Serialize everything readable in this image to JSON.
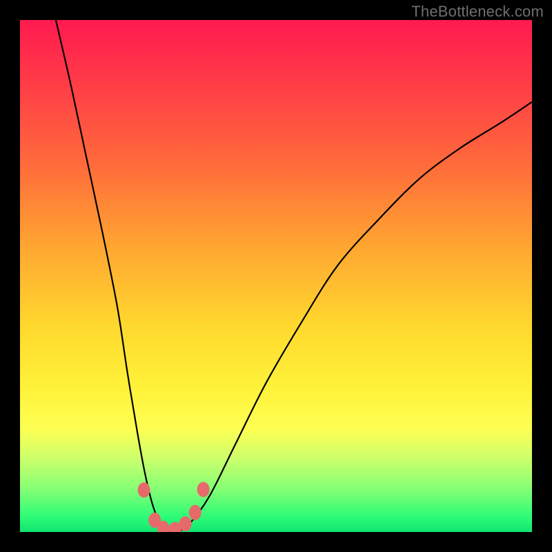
{
  "watermark": "TheBottleneck.com",
  "chart_data": {
    "type": "line",
    "title": "",
    "xlabel": "",
    "ylabel": "",
    "xlim": [
      0,
      100
    ],
    "ylim": [
      0,
      100
    ],
    "series": [
      {
        "name": "bottleneck-curve",
        "x": [
          7,
          10,
          13,
          16,
          19,
          21,
          23,
          24.5,
          26,
          27.5,
          29,
          30.5,
          33,
          37,
          42,
          48,
          55,
          62,
          70,
          78,
          86,
          94,
          100
        ],
        "y": [
          100,
          87,
          73,
          59,
          44,
          31,
          19,
          11,
          5,
          1.5,
          0,
          0,
          1.5,
          7,
          17,
          29,
          41,
          52,
          61,
          69,
          75,
          80,
          84
        ]
      }
    ],
    "markers": [
      {
        "x": 24.2,
        "y": 8.2
      },
      {
        "x": 26.3,
        "y": 2.3
      },
      {
        "x": 28.0,
        "y": 0.7
      },
      {
        "x": 30.3,
        "y": 0.5
      },
      {
        "x": 32.3,
        "y": 1.6
      },
      {
        "x": 34.2,
        "y": 3.8
      },
      {
        "x": 35.8,
        "y": 8.3
      }
    ],
    "marker_color": "#e76a6a",
    "gradient_stops": [
      {
        "pos": 0,
        "color": "#ff1a4f"
      },
      {
        "pos": 100,
        "color": "#11e572"
      }
    ]
  }
}
